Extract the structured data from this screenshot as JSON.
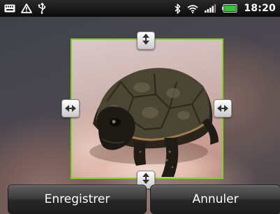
{
  "status_bar": {
    "time": "18:20",
    "icons_left": [
      "keyboard-icon",
      "warning-icon",
      "usb-icon"
    ],
    "icons_right": [
      "bluetooth-icon",
      "wifi-icon",
      "signal-icon",
      "battery-icon"
    ]
  },
  "crop": {
    "frame_color": "#7ed321",
    "handles": [
      "top",
      "left",
      "right",
      "bottom"
    ]
  },
  "actions": {
    "save_label": "Enregistrer",
    "cancel_label": "Annuler"
  }
}
